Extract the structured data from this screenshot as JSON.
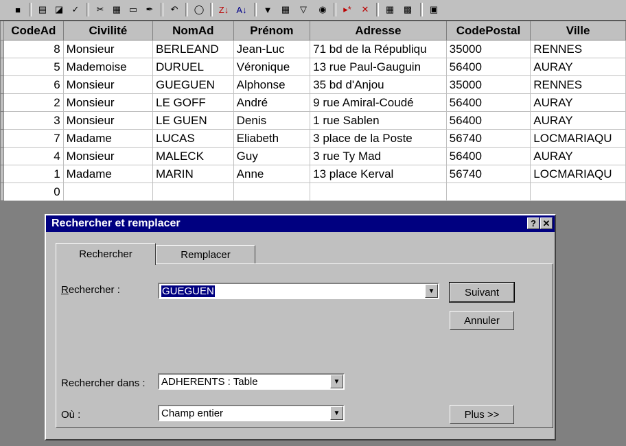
{
  "toolbar": {
    "icons": [
      "save-icon",
      "print-icon",
      "preview-icon",
      "spelling-icon",
      "cut-icon",
      "copy-icon",
      "paste-icon",
      "format-painter-icon",
      "undo-icon",
      "hyperlink-icon",
      "sort-desc-icon",
      "sort-asc-icon",
      "filter-icon",
      "filter-form-icon",
      "apply-filter-icon",
      "find-icon",
      "new-record-icon",
      "delete-record-icon",
      "properties-icon",
      "database-window-icon",
      "new-object-icon"
    ]
  },
  "table": {
    "columns": [
      "CodeAd",
      "Civilité",
      "NomAd",
      "Prénom",
      "Adresse",
      "CodePostal",
      "Ville"
    ],
    "rows": [
      [
        "8",
        "Monsieur",
        "BERLEAND",
        "Jean-Luc",
        "71 bd de la Républiqu",
        "35000",
        "RENNES"
      ],
      [
        "5",
        "Mademoise",
        "DURUEL",
        "Véronique",
        "13 rue Paul-Gauguin",
        "56400",
        "AURAY"
      ],
      [
        "6",
        "Monsieur",
        "GUEGUEN",
        "Alphonse",
        "35 bd d'Anjou",
        "35000",
        "RENNES"
      ],
      [
        "2",
        "Monsieur",
        "LE GOFF",
        "André",
        "9 rue Amiral-Coudé",
        "56400",
        "AURAY"
      ],
      [
        "3",
        "Monsieur",
        "LE GUEN",
        "Denis",
        "1 rue Sablen",
        "56400",
        "AURAY"
      ],
      [
        "7",
        "Madame",
        "LUCAS",
        "Eliabeth",
        "3 place de la Poste",
        "56740",
        "LOCMARIAQU"
      ],
      [
        "4",
        "Monsieur",
        "MALECK",
        "Guy",
        "3 rue Ty Mad",
        "56400",
        "AURAY"
      ],
      [
        "1",
        "Madame",
        "MARIN",
        "Anne",
        "13 place Kerval",
        "56740",
        "LOCMARIAQU"
      ],
      [
        "0",
        "",
        "",
        "",
        "",
        "",
        ""
      ]
    ]
  },
  "dialog": {
    "title": "Rechercher et remplacer",
    "help_label": "?",
    "close_label": "✕",
    "tabs": [
      "Rechercher",
      "Remplacer"
    ],
    "find_label": "Rechercher :",
    "find_value": "GUEGUEN",
    "look_in_label": "Rechercher dans :",
    "look_in_value": "ADHERENTS : Table",
    "match_label": "Où :",
    "match_value": "Champ entier",
    "next_button": "Suivant",
    "cancel_button": "Annuler",
    "more_button": "Plus >>"
  }
}
